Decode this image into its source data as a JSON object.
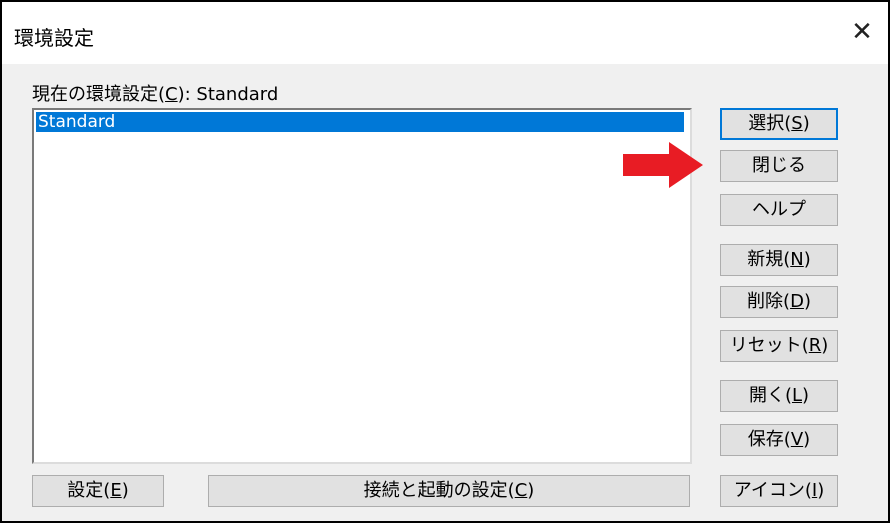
{
  "window": {
    "title": "環境設定",
    "close_glyph": "✕"
  },
  "current": {
    "prefix": "現在の環境設定(",
    "key": "C",
    "suffix": "): Standard"
  },
  "list": {
    "items": [
      {
        "label": "Standard",
        "selected": true
      }
    ]
  },
  "buttons": {
    "select": {
      "text": "選択(",
      "key": "S",
      "end": ")"
    },
    "close": {
      "text": "閉じる"
    },
    "help": {
      "text": "ヘルプ"
    },
    "new": {
      "text": "新規(",
      "key": "N",
      "end": ")"
    },
    "delete": {
      "text": "削除(",
      "key": "D",
      "end": ")"
    },
    "reset": {
      "text": "リセット(",
      "key": "R",
      "end": ")"
    },
    "open": {
      "text": "開く(",
      "key": "L",
      "end": ")"
    },
    "save": {
      "text": "保存(",
      "key": "V",
      "end": ")"
    },
    "icon": {
      "text": "アイコン(",
      "key": "I",
      "end": ")"
    },
    "settings": {
      "text": "設定(",
      "key": "E",
      "end": ")"
    },
    "connection": {
      "text": "接続と起動の設定(",
      "key": "C",
      "end": ")"
    }
  },
  "annotation": {
    "arrow_color": "#e81c24",
    "points_to": "閉じる"
  }
}
